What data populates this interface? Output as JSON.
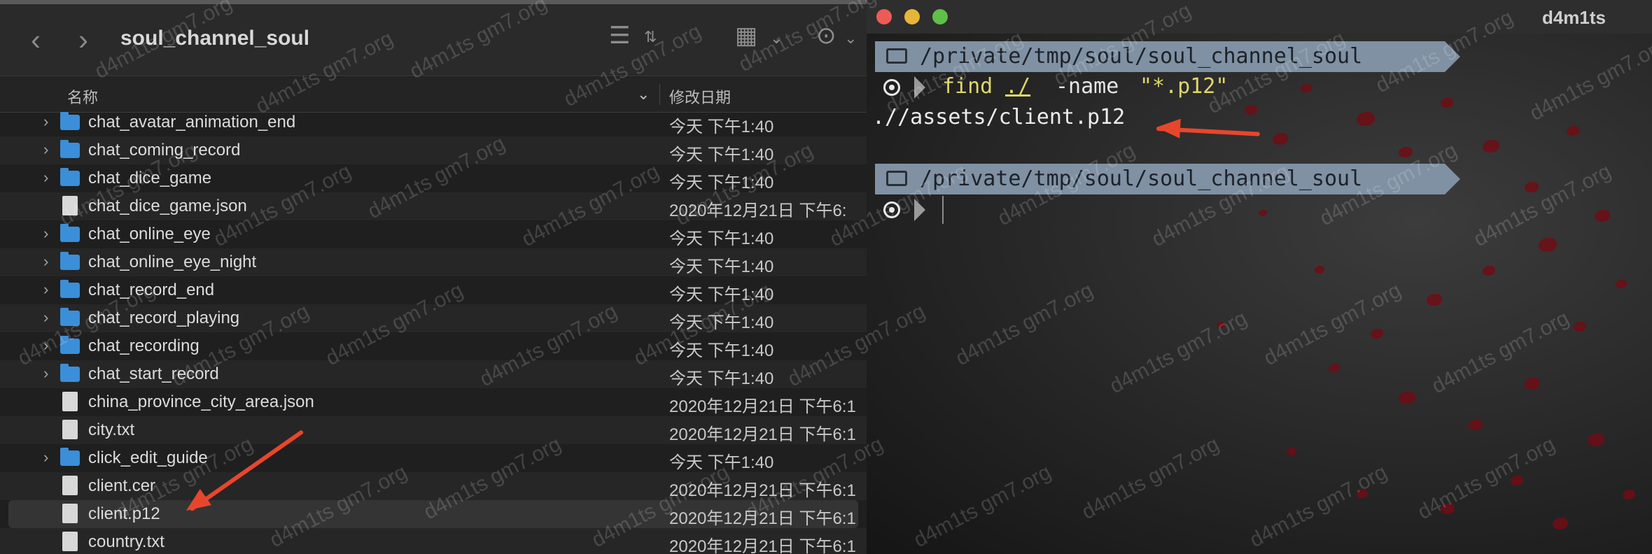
{
  "finder": {
    "title": "soul_channel_soul",
    "columns": {
      "name": "名称",
      "date": "修改日期"
    },
    "rows": [
      {
        "name": "chat_avatar_animation_end",
        "date": "今天 下午1:40",
        "kind": "folder"
      },
      {
        "name": "chat_coming_record",
        "date": "今天 下午1:40",
        "kind": "folder"
      },
      {
        "name": "chat_dice_game",
        "date": "今天 下午1:40",
        "kind": "folder"
      },
      {
        "name": "chat_dice_game.json",
        "date": "2020年12月21日 下午6:",
        "kind": "file"
      },
      {
        "name": "chat_online_eye",
        "date": "今天 下午1:40",
        "kind": "folder"
      },
      {
        "name": "chat_online_eye_night",
        "date": "今天 下午1:40",
        "kind": "folder"
      },
      {
        "name": "chat_record_end",
        "date": "今天 下午1:40",
        "kind": "folder"
      },
      {
        "name": "chat_record_playing",
        "date": "今天 下午1:40",
        "kind": "folder"
      },
      {
        "name": "chat_recording",
        "date": "今天 下午1:40",
        "kind": "folder"
      },
      {
        "name": "chat_start_record",
        "date": "今天 下午1:40",
        "kind": "folder"
      },
      {
        "name": "china_province_city_area.json",
        "date": "2020年12月21日 下午6:1",
        "kind": "file"
      },
      {
        "name": "city.txt",
        "date": "2020年12月21日 下午6:1",
        "kind": "file"
      },
      {
        "name": "click_edit_guide",
        "date": "今天 下午1:40",
        "kind": "folder"
      },
      {
        "name": "client.cer",
        "date": "2020年12月21日 下午6:1",
        "kind": "file"
      },
      {
        "name": "client.p12",
        "date": "2020年12月21日 下午6:1",
        "kind": "file"
      },
      {
        "name": "country.txt",
        "date": "2020年12月21日 下午6:1",
        "kind": "file"
      }
    ],
    "icons": {
      "back": "chevron-left-icon",
      "forward": "chevron-right-icon",
      "view": "list-view-icon",
      "group": "grid-icon",
      "more": "ellipsis-icon"
    }
  },
  "terminal": {
    "window_title": "d4m1ts",
    "prompt_path": "/private/tmp/soul/soul_channel_soul",
    "command": {
      "name": "find",
      "dir": "./",
      "flag": "-name",
      "pattern": "\"*.p12\""
    },
    "output": ".//assets/client.p12",
    "colors": {
      "prompt_bg": "#7f91a3",
      "command": "#e0d66a",
      "arrow": "#e8462c"
    }
  },
  "watermark": "d4m1ts gm7.org"
}
